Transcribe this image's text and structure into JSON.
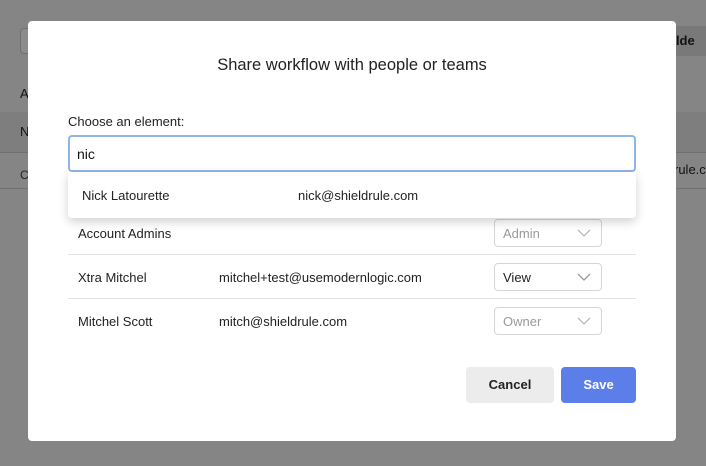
{
  "background": {
    "folder_button_label": "olde",
    "row_a": "A",
    "row_n": "N",
    "row_c": "C",
    "email_tail": "rule.co"
  },
  "modal": {
    "title": "Share workflow with people or teams",
    "choose_label": "Choose an element:",
    "search_value": "nic",
    "dropdown": {
      "name": "Nick Latourette",
      "email": "nick@shieldrule.com"
    },
    "rows": [
      {
        "name": "Account Admins",
        "email": "",
        "role": "Admin",
        "disabled": true
      },
      {
        "name": "Xtra Mitchel",
        "email": "mitchel+test@usemodernlogic.com",
        "role": "View",
        "disabled": false
      },
      {
        "name": "Mitchel Scott",
        "email": "mitch@shieldrule.com",
        "role": "Owner",
        "disabled": true
      }
    ],
    "cancel_label": "Cancel",
    "save_label": "Save"
  },
  "colors": {
    "accent": "#5b7ee8",
    "focus_border": "#8fb4ea"
  },
  "icons": {
    "select_chevron": "chevron-down-icon"
  }
}
